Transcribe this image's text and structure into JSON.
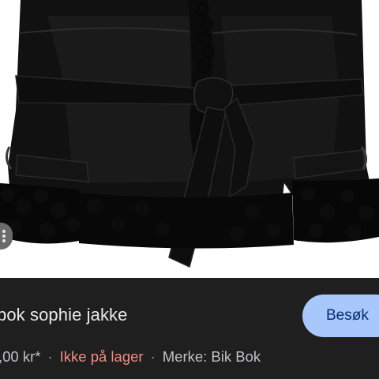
{
  "product": {
    "title": "bok sophie jakke",
    "price": ",00 kr*",
    "stock_status": "Ikke på lager",
    "separator": "·",
    "brand": "Merke: Bik Bok"
  },
  "actions": {
    "visit_label": "Besøk"
  },
  "colors": {
    "panel_background": "#1f1f1f",
    "visit_button": "#a8c7fa",
    "out_of_stock": "#f28b82"
  },
  "icons": {
    "lens_chip": "image-search-icon"
  }
}
